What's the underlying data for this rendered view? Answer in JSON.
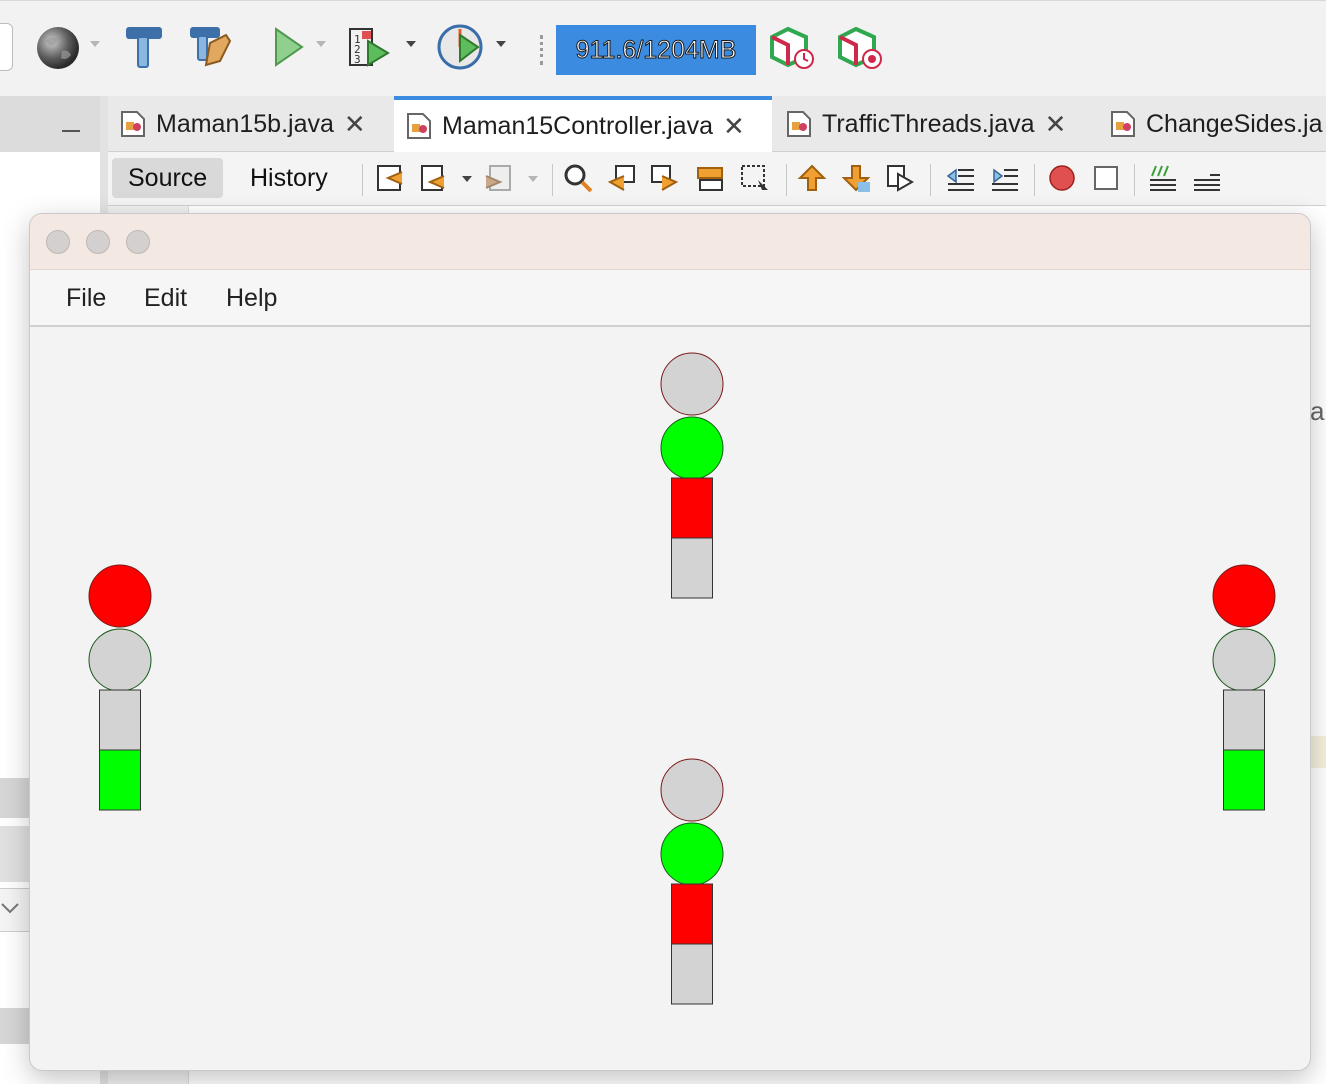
{
  "ide": {
    "memory_label": "911.6/1204MB",
    "tabs": [
      {
        "label": "Maman15b.java",
        "active": false
      },
      {
        "label": "Maman15Controller.java",
        "active": true
      },
      {
        "label": "TrafficThreads.java",
        "active": false
      },
      {
        "label": "ChangeSides.ja",
        "active": false
      }
    ],
    "close_glyph": "✕",
    "source_label": "Source",
    "history_label": "History",
    "peek_text": "a",
    "toolbar_icons": [
      "globe-icon",
      "hammer-icon",
      "clean-build-icon",
      "run-icon",
      "debug-icon",
      "profile-icon",
      "gc-icon",
      "profiler-snapshot-icon"
    ]
  },
  "app": {
    "menu": [
      "File",
      "Edit",
      "Help"
    ],
    "colors": {
      "red": "#ff0000",
      "green": "#00ff00",
      "off": "#d3d3d3",
      "circle_stroke": "#7a1a1a",
      "green_stroke": "#1a5a1a"
    },
    "traffic_lights": [
      {
        "id": "north",
        "vehicle_light": "green",
        "pedestrian": "red"
      },
      {
        "id": "west",
        "vehicle_light": "red",
        "pedestrian": "green"
      },
      {
        "id": "east",
        "vehicle_light": "red",
        "pedestrian": "green"
      },
      {
        "id": "south",
        "vehicle_light": "green",
        "pedestrian": "red"
      }
    ]
  }
}
